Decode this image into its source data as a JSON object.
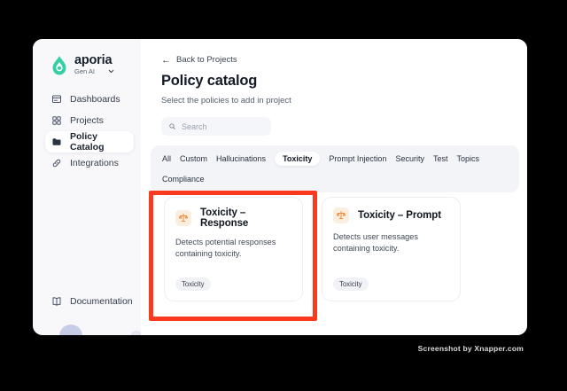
{
  "sidebar": {
    "brand": "aporia",
    "workspace": "Gen AI",
    "items": [
      {
        "label": "Dashboards",
        "icon": "dashboard-icon",
        "active": false
      },
      {
        "label": "Projects",
        "icon": "projects-grid-icon",
        "active": false
      },
      {
        "label": "Policy Catalog",
        "icon": "folder-icon",
        "active": true
      },
      {
        "label": "Integrations",
        "icon": "link-icon",
        "active": false
      }
    ],
    "documentation_label": "Documentation"
  },
  "main": {
    "back_link": "Back to Projects",
    "page_title": "Policy catalog",
    "page_subtitle": "Select the policies to add in project",
    "search_placeholder": "Search",
    "tabs": [
      {
        "label": "All",
        "active": false
      },
      {
        "label": "Custom",
        "active": false
      },
      {
        "label": "Hallucinations",
        "active": false
      },
      {
        "label": "Toxicity",
        "active": true
      },
      {
        "label": "Prompt Injection",
        "active": false
      },
      {
        "label": "Security",
        "active": false
      },
      {
        "label": "Test",
        "active": false
      },
      {
        "label": "Topics",
        "active": false
      },
      {
        "label": "Compliance",
        "active": false
      }
    ],
    "cards": [
      {
        "title": "Toxicity – Response",
        "description": "Detects potential responses containing toxicity.",
        "tag": "Toxicity",
        "icon": "scale-icon",
        "highlighted": true
      },
      {
        "title": "Toxicity – Prompt",
        "description": "Detects user messages containing toxicity.",
        "tag": "Toxicity",
        "icon": "scale-icon",
        "highlighted": false
      }
    ]
  },
  "watermark": "Screenshot by Xnapper.com",
  "colors": {
    "brand_teal": "#35CFA4",
    "highlight_red": "#F93A1E",
    "policy_icon_orange": "#EF8A3C",
    "policy_icon_bg": "#FBEEDF"
  }
}
